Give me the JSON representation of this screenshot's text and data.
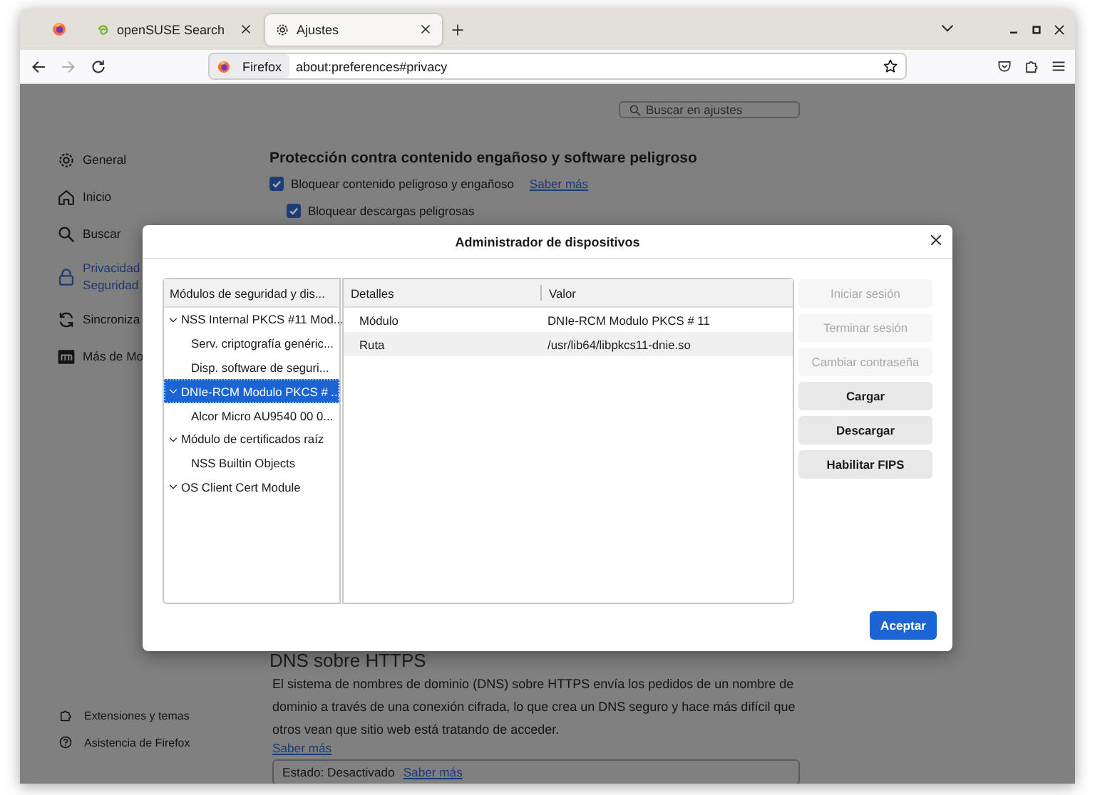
{
  "tabs": [
    {
      "kind": "pinned",
      "selected": false
    },
    {
      "kind": "page",
      "label": "openSUSE Search",
      "selected": false
    },
    {
      "kind": "page",
      "label": "Ajustes",
      "selected": true
    }
  ],
  "toolbar": [
    {
      "kind": "back",
      "disabled": false
    },
    {
      "kind": "forward",
      "disabled": true
    },
    {
      "kind": "reload",
      "disabled": false
    }
  ],
  "address": {
    "identity": "Firefox",
    "url": "about:preferences#privacy"
  },
  "search": {
    "placeholder": "Buscar en ajustes"
  },
  "sidebar": {
    "items": [
      {
        "lines": [
          "General"
        ],
        "selected": false
      },
      {
        "lines": [
          "Inicio"
        ],
        "selected": false
      },
      {
        "lines": [
          "Buscar"
        ],
        "selected": false
      },
      {
        "lines": [
          "Privacidad",
          "Seguridad"
        ],
        "selected": true
      },
      {
        "lines": [
          "Sincroniza"
        ],
        "selected": false
      },
      {
        "lines": [
          "Más de Mo"
        ],
        "selected": false
      }
    ],
    "footer": [
      {
        "label": "Extensiones y temas"
      },
      {
        "label": "Asistencia de Firefox"
      }
    ]
  },
  "protection": {
    "heading": "Protección contra contenido engañoso y software peligroso",
    "options": [
      {
        "label": "Bloquear contenido peligroso y engañoso",
        "checked": true,
        "link": "Saber más",
        "children": [
          {
            "label": "Bloquear descargas peligrosas",
            "checked": true
          }
        ]
      }
    ]
  },
  "dns": {
    "heading": "DNS sobre HTTPS",
    "text": "El sistema de nombres de dominio (DNS) sobre HTTPS envía los pedidos de un nombre de dominio a través de una conexión cifrada, lo que crea un DNS seguro y hace más difícil que otros vean que sitio web está tratando de acceder.",
    "link": "Saber más",
    "status": "Estado: Desactivado",
    "status_link": "Saber más"
  },
  "dialog": {
    "title": "Administrador de dispositivos",
    "tree": {
      "column": "Módulos de seguridad y dis...",
      "items": [
        {
          "label": "NSS Internal PKCS #11 Mod...",
          "expanded": true,
          "selected": false,
          "children": [
            {
              "label": "Serv. criptografía genéric...",
              "selected": false
            },
            {
              "label": "Disp. software de seguri...",
              "selected": false
            }
          ]
        },
        {
          "label": "DNIe-RCM Modulo PKCS # ...",
          "expanded": true,
          "selected": true,
          "children": [
            {
              "label": "Alcor Micro AU9540 00 0...",
              "selected": false
            }
          ]
        },
        {
          "label": "Módulo de certificados raíz",
          "expanded": true,
          "selected": false,
          "children": [
            {
              "label": "NSS Builtin Objects",
              "selected": false
            }
          ]
        },
        {
          "label": "OS Client Cert Module",
          "expanded": true,
          "selected": false
        }
      ]
    },
    "details": {
      "columns": [
        "Detalles",
        "Valor"
      ],
      "rows": [
        {
          "cells": [
            "Módulo",
            "DNIe-RCM Modulo PKCS # 11"
          ]
        },
        {
          "cells": [
            "Ruta",
            "/usr/lib64/libpkcs11-dnie.so"
          ]
        }
      ]
    },
    "buttons": [
      {
        "label": "Iniciar sesión",
        "disabled": true
      },
      {
        "label": "Terminar sesión",
        "disabled": true
      },
      {
        "label": "Cambiar contraseña",
        "disabled": true
      },
      {
        "label": "Cargar",
        "disabled": false
      },
      {
        "label": "Descargar",
        "disabled": false
      },
      {
        "label": "Habilitar FIPS",
        "disabled": false
      }
    ],
    "ok": "Aceptar"
  }
}
